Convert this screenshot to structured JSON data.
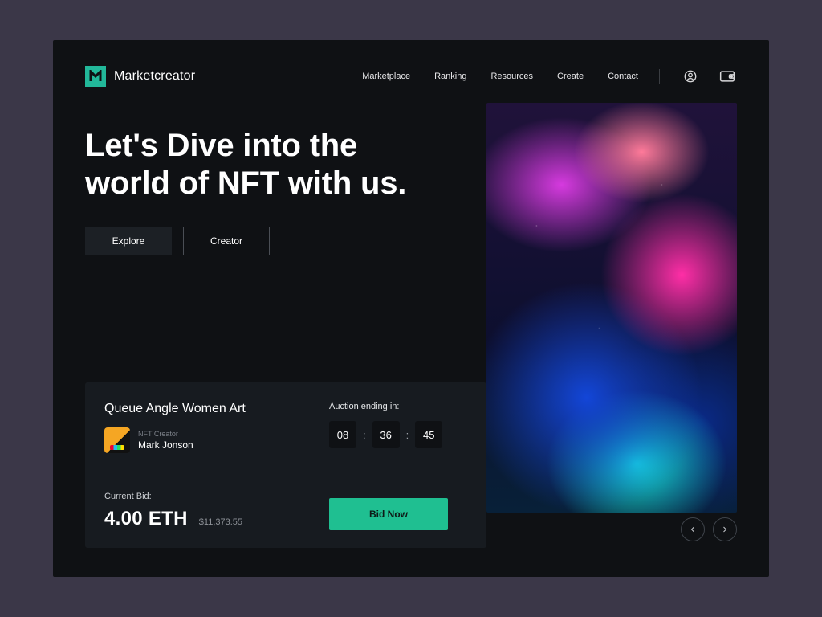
{
  "brand": {
    "name": "Marketcreator"
  },
  "nav": {
    "items": [
      {
        "label": "Marketplace"
      },
      {
        "label": "Ranking"
      },
      {
        "label": "Resources"
      },
      {
        "label": "Create"
      },
      {
        "label": "Contact"
      }
    ]
  },
  "icons": {
    "profile": "profile-icon",
    "wallet": "wallet-icon"
  },
  "hero": {
    "headline": "Let's Dive into the world of NFT with us.",
    "cta_explore": "Explore",
    "cta_creator": "Creator"
  },
  "auction": {
    "title": "Queue Angle Women Art",
    "creator_label": "NFT Creator",
    "creator_name": "Mark Jonson",
    "current_bid_label": "Current Bid:",
    "bid_eth": "4.00 ETH",
    "bid_usd": "$11,373.55",
    "ending_label": "Auction ending in:",
    "timer": {
      "hh": "08",
      "mm": "36",
      "ss": "45"
    },
    "bid_button": "Bid Now"
  },
  "colors": {
    "accent": "#1fbf91",
    "panel": "#171b20",
    "bg": "#0f1114"
  }
}
